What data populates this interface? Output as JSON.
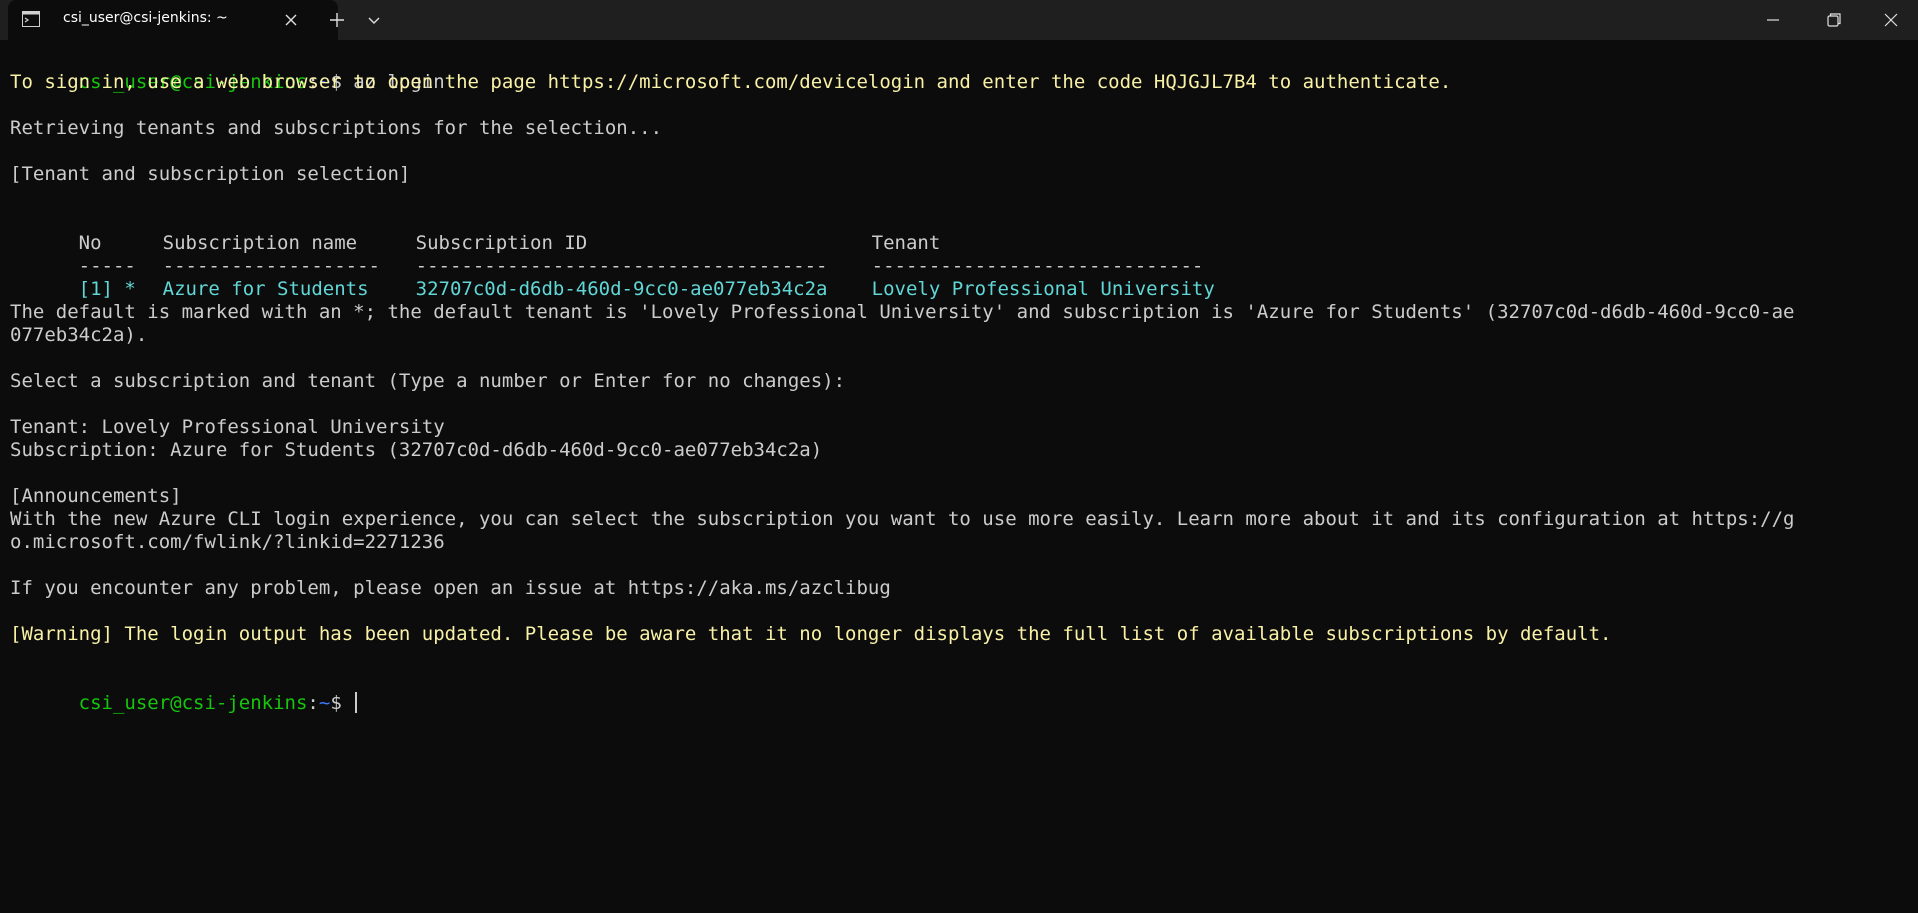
{
  "window": {
    "tab_title": "csi_user@csi-jenkins: ~",
    "icons": {
      "tab": "terminal-icon",
      "close_tab": "close-icon",
      "new_tab": "plus-icon",
      "dropdown": "chevron-down-icon",
      "minimize": "minimize-icon",
      "maximize": "restore-icon",
      "close": "close-icon"
    }
  },
  "colors": {
    "background": "#0c0c0c",
    "titlebar": "#1f1f1f",
    "prompt_user": "#16c60c",
    "prompt_path": "#3b78ff",
    "text": "#cccccc",
    "highlight": "#f9f1a5",
    "table_row": "#61d6d6"
  },
  "terminal": {
    "prompt1": {
      "user_host": "csi_user@csi-jenkins",
      "sep": ":",
      "path": "~",
      "symbol": "$ ",
      "command": "az login"
    },
    "signin": "To sign in, use a web browser to open the page https://microsoft.com/devicelogin and enter the code HQJGJL7B4 to authenticate.",
    "retrieving": "Retrieving tenants and subscriptions for the selection...",
    "selection_header": "[Tenant and subscription selection]",
    "table": {
      "headers": [
        "No",
        "Subscription name",
        "Subscription ID",
        "Tenant"
      ],
      "separators": [
        "-----",
        "-------------------",
        "------------------------------------",
        "-----------------------------"
      ],
      "rows": [
        [
          "[1] *",
          "Azure for Students",
          "32707c0d-d6db-460d-9cc0-ae077eb34c2a",
          "Lovely Professional University"
        ]
      ]
    },
    "default_line1": "The default is marked with an *; the default tenant is 'Lovely Professional University' and subscription is 'Azure for Students' (32707c0d-d6db-460d-9cc0-ae",
    "default_line2": "077eb34c2a).",
    "select_prompt": "Select a subscription and tenant (Type a number or Enter for no changes):",
    "tenant_line": "Tenant: Lovely Professional University",
    "subscription_line": "Subscription: Azure for Students (32707c0d-d6db-460d-9cc0-ae077eb34c2a)",
    "announcements_header": "[Announcements]",
    "announcement_line1": "With the new Azure CLI login experience, you can select the subscription you want to use more easily. Learn more about it and its configuration at https://g",
    "announcement_line2": "o.microsoft.com/fwlink/?linkid=2271236",
    "issue_line": "If you encounter any problem, please open an issue at https://aka.ms/azclibug",
    "warning_line": "[Warning] The login output has been updated. Please be aware that it no longer displays the full list of available subscriptions by default.",
    "prompt2": {
      "user_host": "csi_user@csi-jenkins",
      "sep": ":",
      "path": "~",
      "symbol": "$ "
    }
  }
}
